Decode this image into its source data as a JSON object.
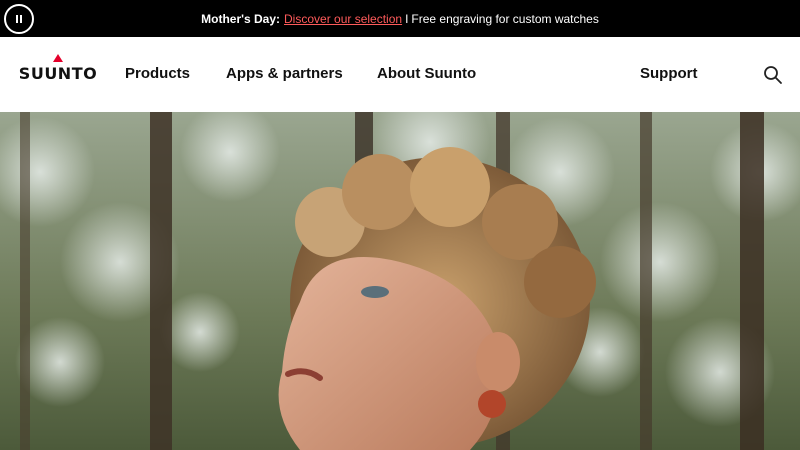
{
  "announcement": {
    "lead": "Mother's Day:",
    "link": "Discover our selection",
    "separator": "I",
    "text": "Free engraving for custom watches"
  },
  "logo": {
    "text": "SUUNTO"
  },
  "nav": {
    "products": "Products",
    "apps": "Apps & partners",
    "about": "About Suunto",
    "support": "Support"
  },
  "icons": {
    "pause": "pause-icon",
    "search": "search-icon"
  },
  "colors": {
    "announcement_bg": "#000000",
    "link_red": "#ff5b5b",
    "logo_red": "#e4002b"
  }
}
